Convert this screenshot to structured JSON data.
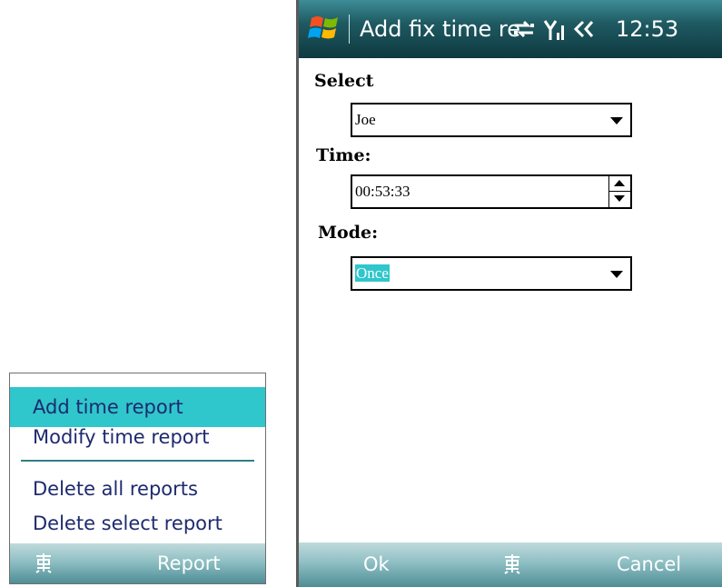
{
  "menu": {
    "items": [
      {
        "label": "Add time report",
        "selected": true
      },
      {
        "label": "Modify time report",
        "selected": false
      },
      {
        "label": "Delete all reports",
        "selected": false
      },
      {
        "label": "Delete select report",
        "selected": false
      }
    ],
    "softbar": {
      "right_label": "Report",
      "left_icon": "keyboard-icon"
    }
  },
  "titlebar": {
    "title": "Add fix time re",
    "clock": "12:53",
    "icons": [
      "windows-start-icon",
      "connectivity-icon",
      "signal-icon",
      "speaker-icon"
    ]
  },
  "form": {
    "select_label": "Select",
    "select_value": "Joe",
    "time_label": "Time:",
    "time_value": "00:53:33",
    "mode_label": "Mode:",
    "mode_value": "Once"
  },
  "softbar": {
    "left_label": "Ok",
    "right_label": "Cancel",
    "center_icon": "keyboard-icon"
  },
  "colors": {
    "accent": "#2fc6cc",
    "titlebar": "#1f5a62",
    "menu_text": "#1e2a6e"
  }
}
